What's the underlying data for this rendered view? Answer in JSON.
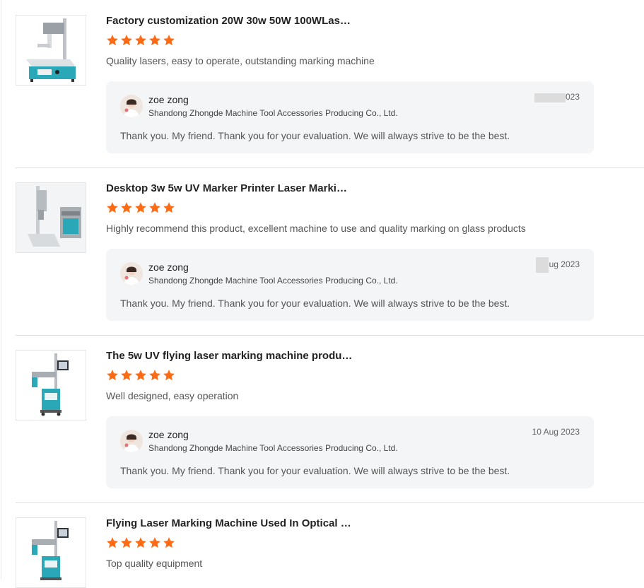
{
  "reviews": [
    {
      "product_title": "Factory customization 20W 30w 50W 100WLas…",
      "rating": 5,
      "comment": "Quality lasers, easy to operate,  outstanding marking machine",
      "reply": {
        "seller_name": "zoe zong",
        "company": "Shandong Zhongde Machine Tool Accessories Producing Co., Ltd.",
        "date": "023",
        "text": "Thank you. My friend. Thank you for your evaluation. We will always strive to be the best."
      }
    },
    {
      "product_title": "Desktop 3w 5w UV Marker Printer Laser Marki…",
      "rating": 5,
      "comment": "Highly recommend this product, excellent machine to use and quality marking on glass products",
      "reply": {
        "seller_name": "zoe zong",
        "company": "Shandong Zhongde Machine Tool Accessories Producing Co., Ltd.",
        "date": "ug 2023",
        "text": "Thank you. My friend. Thank you for your evaluation. We will always strive to be the best."
      }
    },
    {
      "product_title": "The 5w UV flying laser marking machine produ…",
      "rating": 5,
      "comment": "Well designed,  easy operation",
      "reply": {
        "seller_name": "zoe zong",
        "company": "Shandong Zhongde Machine Tool Accessories Producing Co., Ltd.",
        "date": "10 Aug 2023",
        "text": "Thank you. My friend. Thank you for your evaluation. We will always strive to be the best."
      }
    },
    {
      "product_title": "Flying Laser Marking Machine Used In Optical …",
      "rating": 5,
      "comment": "Top quality equipment"
    }
  ],
  "colors": {
    "star": "#ff6a14",
    "reply_bg": "#f4f5f7",
    "divider": "#dedede",
    "machine_teal": "#29b6c4"
  }
}
